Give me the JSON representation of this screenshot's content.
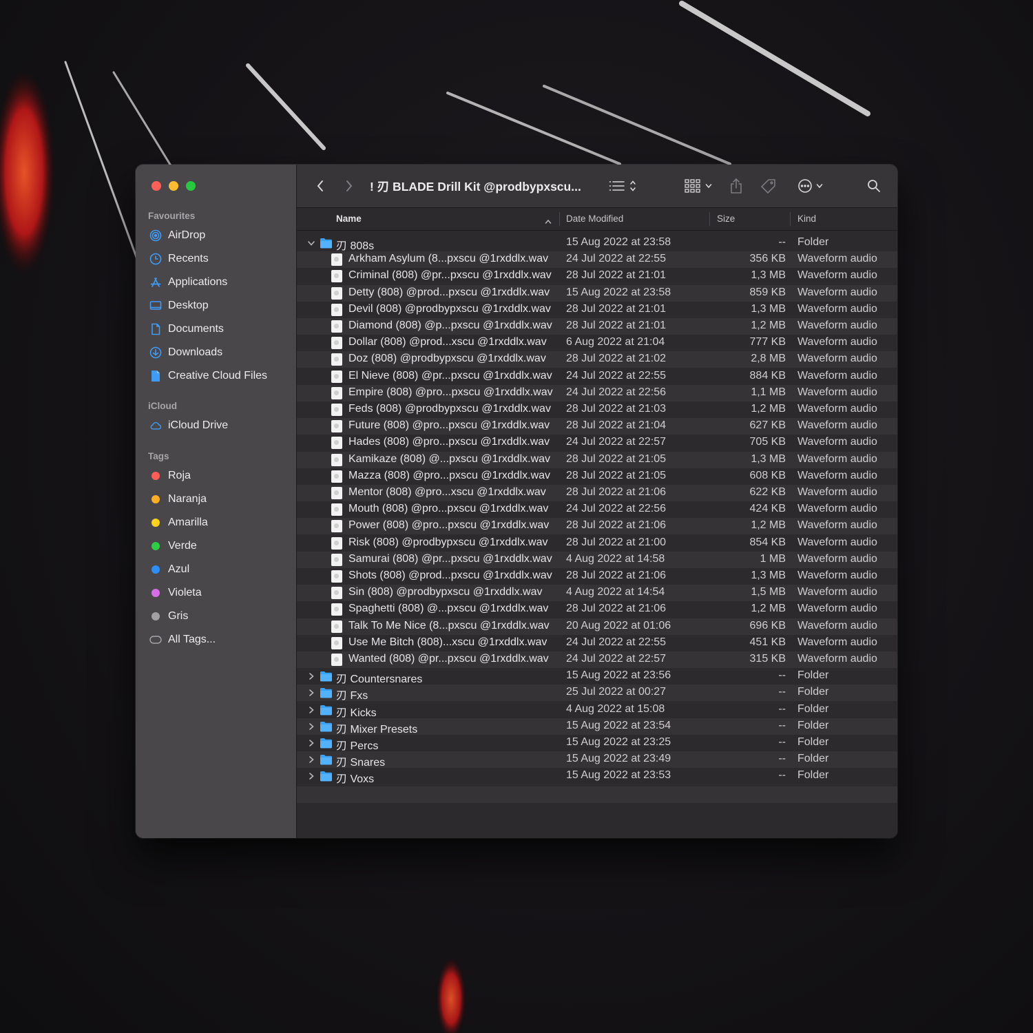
{
  "window": {
    "title": "! 刃 BLADE Drill Kit @prodbypxscu..."
  },
  "sidebar": {
    "favourites_label": "Favourites",
    "favourites": [
      {
        "label": "AirDrop",
        "icon": "airdrop-icon"
      },
      {
        "label": "Recents",
        "icon": "clock-icon"
      },
      {
        "label": "Applications",
        "icon": "applications-icon"
      },
      {
        "label": "Desktop",
        "icon": "desktop-icon"
      },
      {
        "label": "Documents",
        "icon": "document-icon"
      },
      {
        "label": "Downloads",
        "icon": "download-icon"
      },
      {
        "label": "Creative Cloud Files",
        "icon": "creative-cloud-file-icon"
      }
    ],
    "icloud_label": "iCloud",
    "icloud": [
      {
        "label": "iCloud Drive",
        "icon": "cloud-icon"
      }
    ],
    "tags_label": "Tags",
    "tags": [
      {
        "label": "Roja",
        "color": "#fe5e57"
      },
      {
        "label": "Naranja",
        "color": "#fdae24"
      },
      {
        "label": "Amarilla",
        "color": "#fcd21c"
      },
      {
        "label": "Verde",
        "color": "#2ecd46"
      },
      {
        "label": "Azul",
        "color": "#2c8ff7"
      },
      {
        "label": "Violeta",
        "color": "#d86ee6"
      },
      {
        "label": "Gris",
        "color": "#a1a0a3"
      }
    ],
    "all_tags": "All Tags..."
  },
  "columns": {
    "name": "Name",
    "date": "Date Modified",
    "size": "Size",
    "kind": "Kind"
  },
  "rows": [
    {
      "type": "folder",
      "expanded": true,
      "name": "刃 808s",
      "date": "15 Aug 2022 at 23:58",
      "size": "--",
      "kind": "Folder"
    },
    {
      "type": "file",
      "name": "Arkham Asylum (8...pxscu @1rxddlx.wav",
      "date": "24 Jul 2022 at 22:55",
      "size": "356 KB",
      "kind": "Waveform audio"
    },
    {
      "type": "file",
      "name": "Criminal (808) @pr...pxscu @1rxddlx.wav",
      "date": "28 Jul 2022 at 21:01",
      "size": "1,3 MB",
      "kind": "Waveform audio"
    },
    {
      "type": "file",
      "name": "Detty (808) @prod...pxscu @1rxddlx.wav",
      "date": "15 Aug 2022 at 23:58",
      "size": "859 KB",
      "kind": "Waveform audio"
    },
    {
      "type": "file",
      "name": "Devil (808) @prodbypxscu @1rxddlx.wav",
      "date": "28 Jul 2022 at 21:01",
      "size": "1,3 MB",
      "kind": "Waveform audio"
    },
    {
      "type": "file",
      "name": "Diamond (808) @p...pxscu @1rxddlx.wav",
      "date": "28 Jul 2022 at 21:01",
      "size": "1,2 MB",
      "kind": "Waveform audio"
    },
    {
      "type": "file",
      "name": "Dollar (808) @prod...xscu @1rxddlx.wav",
      "date": "6 Aug 2022 at 21:04",
      "size": "777 KB",
      "kind": "Waveform audio"
    },
    {
      "type": "file",
      "name": "Doz (808) @prodbypxscu @1rxddlx.wav",
      "date": "28 Jul 2022 at 21:02",
      "size": "2,8 MB",
      "kind": "Waveform audio"
    },
    {
      "type": "file",
      "name": "El Nieve (808) @pr...pxscu @1rxddlx.wav",
      "date": "24 Jul 2022 at 22:55",
      "size": "884 KB",
      "kind": "Waveform audio"
    },
    {
      "type": "file",
      "name": "Empire (808) @pro...pxscu @1rxddlx.wav",
      "date": "24 Jul 2022 at 22:56",
      "size": "1,1 MB",
      "kind": "Waveform audio"
    },
    {
      "type": "file",
      "name": "Feds (808) @prodbypxscu @1rxddlx.wav",
      "date": "28 Jul 2022 at 21:03",
      "size": "1,2 MB",
      "kind": "Waveform audio"
    },
    {
      "type": "file",
      "name": "Future (808) @pro...pxscu @1rxddlx.wav",
      "date": "28 Jul 2022 at 21:04",
      "size": "627 KB",
      "kind": "Waveform audio"
    },
    {
      "type": "file",
      "name": "Hades (808) @pro...pxscu @1rxddlx.wav",
      "date": "24 Jul 2022 at 22:57",
      "size": "705 KB",
      "kind": "Waveform audio"
    },
    {
      "type": "file",
      "name": "Kamikaze (808) @...pxscu @1rxddlx.wav",
      "date": "28 Jul 2022 at 21:05",
      "size": "1,3 MB",
      "kind": "Waveform audio"
    },
    {
      "type": "file",
      "name": "Mazza (808) @pro...pxscu @1rxddlx.wav",
      "date": "28 Jul 2022 at 21:05",
      "size": "608 KB",
      "kind": "Waveform audio"
    },
    {
      "type": "file",
      "name": "Mentor (808) @pro...xscu @1rxddlx.wav",
      "date": "28 Jul 2022 at 21:06",
      "size": "622 KB",
      "kind": "Waveform audio"
    },
    {
      "type": "file",
      "name": "Mouth (808) @pro...pxscu @1rxddlx.wav",
      "date": "24 Jul 2022 at 22:56",
      "size": "424 KB",
      "kind": "Waveform audio"
    },
    {
      "type": "file",
      "name": "Power (808) @pro...pxscu @1rxddlx.wav",
      "date": "28 Jul 2022 at 21:06",
      "size": "1,2 MB",
      "kind": "Waveform audio"
    },
    {
      "type": "file",
      "name": "Risk (808) @prodbypxscu @1rxddlx.wav",
      "date": "28 Jul 2022 at 21:00",
      "size": "854 KB",
      "kind": "Waveform audio"
    },
    {
      "type": "file",
      "name": "Samurai (808) @pr...pxscu @1rxddlx.wav",
      "date": "4 Aug 2022 at 14:58",
      "size": "1 MB",
      "kind": "Waveform audio"
    },
    {
      "type": "file",
      "name": "Shots (808) @prod...pxscu @1rxddlx.wav",
      "date": "28 Jul 2022 at 21:06",
      "size": "1,3 MB",
      "kind": "Waveform audio"
    },
    {
      "type": "file",
      "name": "Sin (808) @prodbypxscu @1rxddlx.wav",
      "date": "4 Aug 2022 at 14:54",
      "size": "1,5 MB",
      "kind": "Waveform audio"
    },
    {
      "type": "file",
      "name": "Spaghetti (808) @...pxscu @1rxddlx.wav",
      "date": "28 Jul 2022 at 21:06",
      "size": "1,2 MB",
      "kind": "Waveform audio"
    },
    {
      "type": "file",
      "name": "Talk To Me Nice (8...pxscu @1rxddlx.wav",
      "date": "20 Aug 2022 at 01:06",
      "size": "696 KB",
      "kind": "Waveform audio"
    },
    {
      "type": "file",
      "name": "Use Me Bitch (808)...xscu @1rxddlx.wav",
      "date": "24 Jul 2022 at 22:55",
      "size": "451 KB",
      "kind": "Waveform audio"
    },
    {
      "type": "file",
      "name": "Wanted (808) @pr...pxscu @1rxddlx.wav",
      "date": "24 Jul 2022 at 22:57",
      "size": "315 KB",
      "kind": "Waveform audio"
    },
    {
      "type": "folder",
      "expanded": false,
      "name": "刃 Countersnares",
      "date": "15 Aug 2022 at 23:56",
      "size": "--",
      "kind": "Folder"
    },
    {
      "type": "folder",
      "expanded": false,
      "name": "刃 Fxs",
      "date": "25 Jul 2022 at 00:27",
      "size": "--",
      "kind": "Folder"
    },
    {
      "type": "folder",
      "expanded": false,
      "name": "刃 Kicks",
      "date": "4 Aug 2022 at 15:08",
      "size": "--",
      "kind": "Folder"
    },
    {
      "type": "folder",
      "expanded": false,
      "name": "刃 Mixer Presets",
      "date": "15 Aug 2022 at 23:54",
      "size": "--",
      "kind": "Folder"
    },
    {
      "type": "folder",
      "expanded": false,
      "name": "刃 Percs",
      "date": "15 Aug 2022 at 23:25",
      "size": "--",
      "kind": "Folder"
    },
    {
      "type": "folder",
      "expanded": false,
      "name": "刃 Snares",
      "date": "15 Aug 2022 at 23:49",
      "size": "--",
      "kind": "Folder"
    },
    {
      "type": "folder",
      "expanded": false,
      "name": "刃 Voxs",
      "date": "15 Aug 2022 at 23:53",
      "size": "--",
      "kind": "Folder"
    }
  ],
  "colors": {
    "accent_folder": "#3aa2f5",
    "sidebar_icon": "#3f9cf6"
  }
}
